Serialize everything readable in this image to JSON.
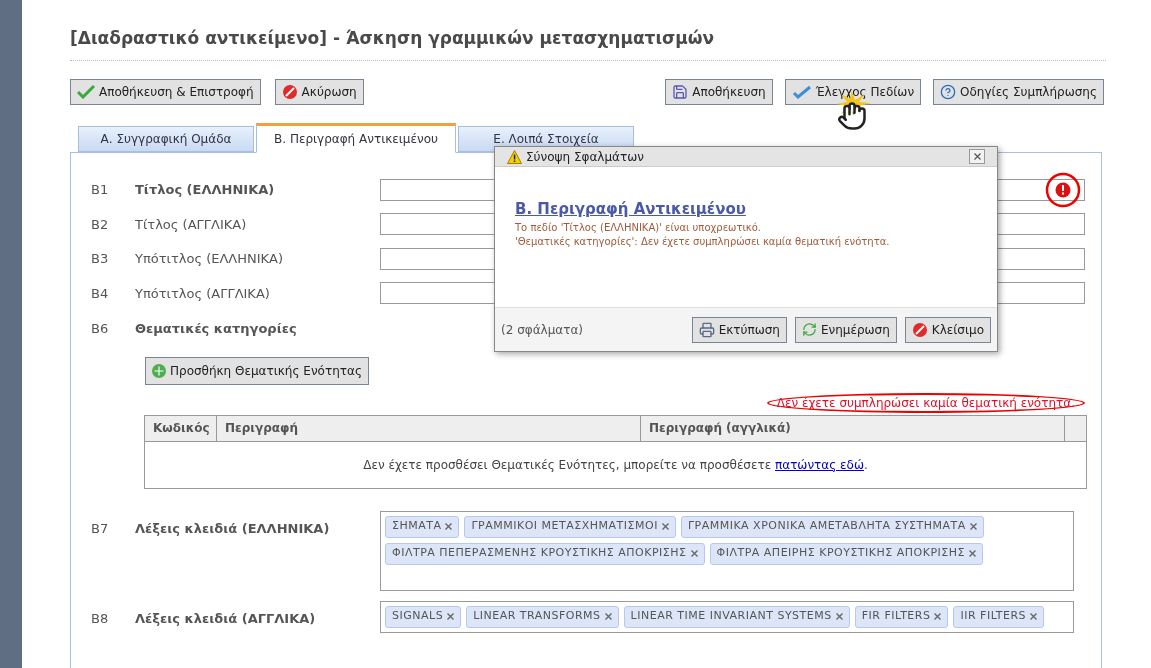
{
  "title": "[Διαδραστικό αντικείμενο] - Άσκηση γραμμικών μετασχηματισμών",
  "left_buttons": [
    {
      "label": "Αποθήκευση & Επιστροφή",
      "kind": "check"
    },
    {
      "label": "Ακύρωση",
      "kind": "cancel"
    }
  ],
  "right_buttons": [
    {
      "label": "Αποθήκευση",
      "kind": "save"
    },
    {
      "label": "Έλεγχος Πεδίων",
      "kind": "spellcheck"
    },
    {
      "label": "Οδηγίες Συμπλήρωσης",
      "kind": "help"
    }
  ],
  "tabs": [
    {
      "label": "Α. Συγγραφική Ομάδα",
      "selected": false
    },
    {
      "label": "Β. Περιγραφή Αντικειμένου",
      "selected": true
    },
    {
      "label": "Ε. Λοιπά Στοιχεία",
      "selected": false
    }
  ],
  "fields": [
    {
      "code": "Β1",
      "label": "Τίτλος (ΕΛΛΗΝΙΚΑ)",
      "required": true,
      "error": true
    },
    {
      "code": "Β2",
      "label": "Τίτλος (ΑΓΓΛΙΚΑ)",
      "required": false,
      "error": false
    },
    {
      "code": "Β3",
      "label": "Υπότιτλος (ΕΛΛΗΝΙΚΑ)",
      "required": false,
      "error": false
    },
    {
      "code": "Β4",
      "label": "Υπότιτλος (ΑΓΓΛΙΚΑ)",
      "required": false,
      "error": false
    }
  ],
  "topics": {
    "code": "Β6",
    "label": "Θεματικές κατηγορίες",
    "add_button": "Προσθήκη Θεματικής Ενότητας",
    "error": "Δεν έχετε συμπληρώσει καμία θεματική ενότητα.",
    "columns": [
      "Κωδικός",
      "Περιγραφή",
      "Περιγραφή (αγγλικά)"
    ],
    "empty_text": "Δεν έχετε προσθέσει Θεματικές Ενότητες, μπορείτε να προσθέσετε",
    "empty_link": "πατώντας εδώ",
    "empty_end": "."
  },
  "keywords": [
    {
      "code": "Β7",
      "label": "Λέξεις κλειδιά (ΕΛΛΗΝΙΚΑ)",
      "tags": [
        "ΣΗΜΑΤΑ",
        "ΓΡΑΜΜΙΚΟΙ ΜΕΤΑΣΧΗΜΑΤΙΣΜΟΙ",
        "ΓΡΑΜΜΙΚΑ ΧΡΟΝΙΚΑ ΑΜΕΤΑΒΛΗΤΑ ΣΥΣΤΗΜΑΤΑ",
        "ΦΙΛΤΡΑ ΠΕΠΕΡΑΣΜΕΝΗΣ ΚΡΟΥΣΤΙΚΗΣ ΑΠΟΚΡΙΣΗΣ",
        "ΦΙΛΤΡΑ ΑΠΕΙΡΗΣ ΚΡΟΥΣΤΙΚΗΣ ΑΠΟΚΡΙΣΗΣ"
      ]
    },
    {
      "code": "Β8",
      "label": "Λέξεις κλειδιά (ΑΓΓΛΙΚΑ)",
      "tags": [
        "SIGNALS",
        "LINEAR TRANSFORMS",
        "LINEAR TIME INVARIANT SYSTEMS",
        "FIR FILTERS",
        "IIR FILTERS"
      ]
    }
  ],
  "dialog": {
    "title": "Σύνοψη Σφαλμάτων",
    "section": "Β. Περιγραφή Αντικειμένου",
    "errors": [
      "Το πεδίο 'Τίτλος (ΕΛΛΗΝΙΚΑ)' είναι υποχρεωτικό.",
      "'Θεματικές κατηγορίες': Δεν έχετε συμπληρώσει καμία θεματική ενότητα."
    ],
    "count": "(2 σφάλματα)",
    "buttons": [
      {
        "label": "Εκτύπωση",
        "kind": "print"
      },
      {
        "label": "Ενημέρωση",
        "kind": "refresh"
      },
      {
        "label": "Κλείσιμο",
        "kind": "cancel"
      }
    ]
  }
}
